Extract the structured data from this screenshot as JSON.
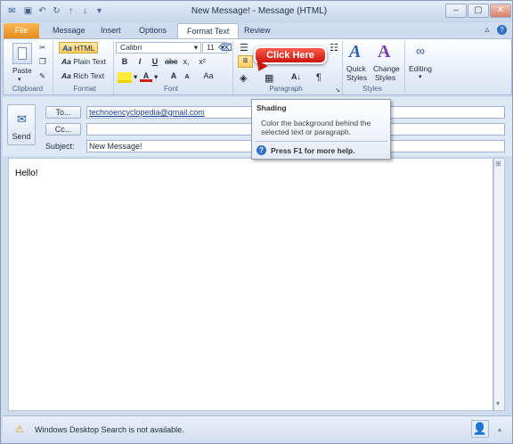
{
  "window": {
    "title": "New Message! - Message (HTML)"
  },
  "tabs": [
    {
      "label": "File"
    },
    {
      "label": "Message"
    },
    {
      "label": "Insert"
    },
    {
      "label": "Options"
    },
    {
      "label": "Format Text"
    },
    {
      "label": "Review"
    }
  ],
  "ribbon": {
    "clipboard": {
      "label": "Clipboard",
      "paste": "Paste"
    },
    "format": {
      "label": "Format",
      "html": "HTML",
      "plain": "Plain Text",
      "rich": "Rich Text",
      "aa": "Aa"
    },
    "font": {
      "label": "Font",
      "name": "Calibri",
      "size": "11",
      "bold": "B",
      "italic": "I",
      "underline": "U",
      "strike": "abc",
      "sub": "x,",
      "sup": "x²",
      "grow": "A",
      "shrink": "A",
      "case": "Aa"
    },
    "paragraph": {
      "label": "Paragraph",
      "pilcrow": "¶"
    },
    "styles": {
      "label": "Styles",
      "quick": "Quick",
      "quick2": "Styles",
      "change": "Change",
      "change2": "Styles"
    },
    "editing": {
      "label": "Editing"
    }
  },
  "callout": "Click Here",
  "tooltip": {
    "title": "Shading",
    "body": "Color the background behind the selected text or paragraph.",
    "help": "Press F1 for more help."
  },
  "compose": {
    "send": "Send",
    "to_label": "To...",
    "to_value": "technoencyclopedia@gmail.com",
    "cc_label": "Cc...",
    "cc_value": "",
    "subject_label": "Subject:",
    "subject_value": "New Message!"
  },
  "body_text": "Hello!",
  "status_text": "Windows Desktop Search is not available.",
  "colors": {
    "file_tab": "#e48b1b",
    "callout": "#d41e12",
    "accent": "#cfdcee"
  }
}
